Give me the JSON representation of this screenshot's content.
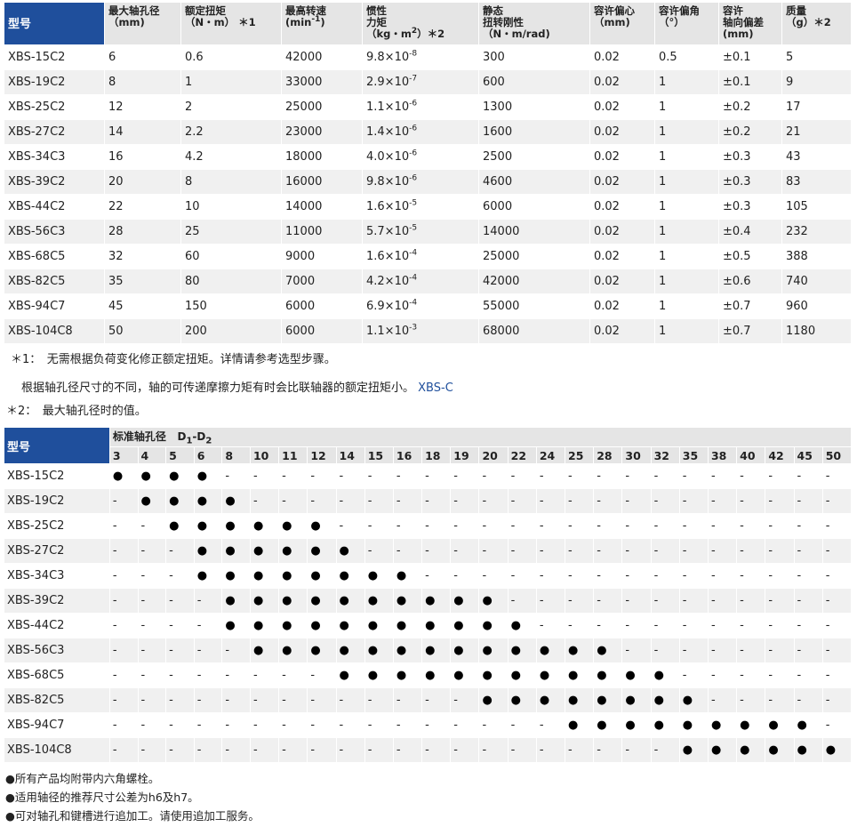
{
  "spec_table": {
    "headers": {
      "model": "型号",
      "max_bore": [
        "最大轴孔径",
        "（mm)"
      ],
      "torque": [
        "额定扭矩",
        "（N・m）  ＊1"
      ],
      "speed": [
        "最高转速",
        "(min",
        "-1",
        ")"
      ],
      "inertia": [
        "惯性",
        "力矩",
        "（kg・m",
        "2",
        "）＊2"
      ],
      "stiffness": [
        "静态",
        "扭转刚性",
        "（N・m/rad)"
      ],
      "ecc": [
        "容许偏心",
        "（mm)"
      ],
      "ang": [
        "容许偏角",
        "（°）"
      ],
      "axial": [
        "容许",
        "轴向偏差",
        "(mm)"
      ],
      "mass": [
        "质量",
        "（g）＊2"
      ]
    },
    "rows": [
      {
        "model": "XBS-15C2",
        "bore": "6",
        "torque": "0.6",
        "speed": "42000",
        "inertia_base": "9.8×10",
        "inertia_exp": "-8",
        "stiffness": "300",
        "ecc": "0.02",
        "ang": "0.5",
        "axial": "±0.1",
        "mass": "5"
      },
      {
        "model": "XBS-19C2",
        "bore": "8",
        "torque": "1",
        "speed": "33000",
        "inertia_base": "2.9×10",
        "inertia_exp": "-7",
        "stiffness": "600",
        "ecc": "0.02",
        "ang": "1",
        "axial": "±0.1",
        "mass": "9"
      },
      {
        "model": "XBS-25C2",
        "bore": "12",
        "torque": "2",
        "speed": "25000",
        "inertia_base": "1.1×10",
        "inertia_exp": "-6",
        "stiffness": "1300",
        "ecc": "0.02",
        "ang": "1",
        "axial": "±0.2",
        "mass": "17"
      },
      {
        "model": "XBS-27C2",
        "bore": "14",
        "torque": "2.2",
        "speed": "23000",
        "inertia_base": "1.4×10",
        "inertia_exp": "-6",
        "stiffness": "1600",
        "ecc": "0.02",
        "ang": "1",
        "axial": "±0.2",
        "mass": "21"
      },
      {
        "model": "XBS-34C3",
        "bore": "16",
        "torque": "4.2",
        "speed": "18000",
        "inertia_base": "4.0×10",
        "inertia_exp": "-6",
        "stiffness": "2500",
        "ecc": "0.02",
        "ang": "1",
        "axial": "±0.3",
        "mass": "43"
      },
      {
        "model": "XBS-39C2",
        "bore": "20",
        "torque": "8",
        "speed": "16000",
        "inertia_base": "9.8×10",
        "inertia_exp": "-6",
        "stiffness": "4600",
        "ecc": "0.02",
        "ang": "1",
        "axial": "±0.3",
        "mass": "83"
      },
      {
        "model": "XBS-44C2",
        "bore": "22",
        "torque": "10",
        "speed": "14000",
        "inertia_base": "1.6×10",
        "inertia_exp": "-5",
        "stiffness": "6000",
        "ecc": "0.02",
        "ang": "1",
        "axial": "±0.3",
        "mass": "105"
      },
      {
        "model": "XBS-56C3",
        "bore": "28",
        "torque": "25",
        "speed": "11000",
        "inertia_base": "5.7×10",
        "inertia_exp": "-5",
        "stiffness": "14000",
        "ecc": "0.02",
        "ang": "1",
        "axial": "±0.4",
        "mass": "232"
      },
      {
        "model": "XBS-68C5",
        "bore": "32",
        "torque": "60",
        "speed": "9000",
        "inertia_base": "1.6×10",
        "inertia_exp": "-4",
        "stiffness": "25000",
        "ecc": "0.02",
        "ang": "1",
        "axial": "±0.5",
        "mass": "388"
      },
      {
        "model": "XBS-82C5",
        "bore": "35",
        "torque": "80",
        "speed": "7000",
        "inertia_base": "4.2×10",
        "inertia_exp": "-4",
        "stiffness": "42000",
        "ecc": "0.02",
        "ang": "1",
        "axial": "±0.6",
        "mass": "740"
      },
      {
        "model": "XBS-94C7",
        "bore": "45",
        "torque": "150",
        "speed": "6000",
        "inertia_base": "6.9×10",
        "inertia_exp": "-4",
        "stiffness": "55000",
        "ecc": "0.02",
        "ang": "1",
        "axial": "±0.7",
        "mass": "960"
      },
      {
        "model": "XBS-104C8",
        "bore": "50",
        "torque": "200",
        "speed": "6000",
        "inertia_base": "1.1×10",
        "inertia_exp": "-3",
        "stiffness": "68000",
        "ecc": "0.02",
        "ang": "1",
        "axial": "±0.7",
        "mass": "1180"
      }
    ]
  },
  "notes": {
    "n1": "＊1：　无需根据负荷变化修正额定扭矩。详情请参考选型步骤。",
    "n1b_text": "根据轴孔径尺寸的不同，轴的可传递摩擦力矩有时会比联轴器的额定扭矩小。",
    "n1b_link": "XBS-C",
    "n2": "＊2：　最大轴孔径时的值。"
  },
  "bore_table": {
    "model_header": "型号",
    "group_header": "标准轴孔径",
    "group_symbol_d": "D",
    "group_sub1": "1",
    "group_dash": "-D",
    "group_sub2": "2",
    "sizes": [
      "3",
      "4",
      "5",
      "6",
      "8",
      "10",
      "11",
      "12",
      "14",
      "15",
      "16",
      "18",
      "19",
      "20",
      "22",
      "24",
      "25",
      "28",
      "30",
      "32",
      "35",
      "38",
      "40",
      "42",
      "45",
      "50"
    ],
    "dot_symbol": "●",
    "dash_symbol": "-",
    "rows": [
      {
        "model": "XBS-15C2",
        "available": [
          "3",
          "4",
          "5",
          "6"
        ]
      },
      {
        "model": "XBS-19C2",
        "available": [
          "4",
          "5",
          "6",
          "8"
        ]
      },
      {
        "model": "XBS-25C2",
        "available": [
          "5",
          "6",
          "8",
          "10",
          "11",
          "12"
        ]
      },
      {
        "model": "XBS-27C2",
        "available": [
          "6",
          "8",
          "10",
          "11",
          "12",
          "14"
        ]
      },
      {
        "model": "XBS-34C3",
        "available": [
          "6",
          "8",
          "10",
          "11",
          "12",
          "14",
          "15",
          "16"
        ]
      },
      {
        "model": "XBS-39C2",
        "available": [
          "8",
          "10",
          "11",
          "12",
          "14",
          "15",
          "16",
          "18",
          "19",
          "20"
        ]
      },
      {
        "model": "XBS-44C2",
        "available": [
          "8",
          "10",
          "11",
          "12",
          "14",
          "15",
          "16",
          "18",
          "19",
          "20",
          "22"
        ]
      },
      {
        "model": "XBS-56C3",
        "available": [
          "10",
          "11",
          "12",
          "14",
          "15",
          "16",
          "18",
          "19",
          "20",
          "22",
          "24",
          "25",
          "28"
        ]
      },
      {
        "model": "XBS-68C5",
        "available": [
          "14",
          "15",
          "16",
          "18",
          "19",
          "20",
          "22",
          "24",
          "25",
          "28",
          "30",
          "32"
        ]
      },
      {
        "model": "XBS-82C5",
        "available": [
          "20",
          "22",
          "24",
          "25",
          "28",
          "30",
          "32",
          "35"
        ]
      },
      {
        "model": "XBS-94C7",
        "available": [
          "25",
          "28",
          "30",
          "32",
          "35",
          "38",
          "40",
          "42",
          "45"
        ]
      },
      {
        "model": "XBS-104C8",
        "available": [
          "35",
          "38",
          "40",
          "42",
          "45",
          "50"
        ]
      }
    ]
  },
  "footer": [
    "●所有产品均附带内六角螺栓。",
    "●适用轴径的推荐尺寸公差为h6及h7。",
    "●可对轴孔和键槽进行追加工。请使用追加工服务。"
  ],
  "colors": {
    "header_blue": "#1f4f9c",
    "header_gray": "#e5e5e5",
    "row_alt": "#f0f0f0",
    "link": "#1f4f9c"
  }
}
